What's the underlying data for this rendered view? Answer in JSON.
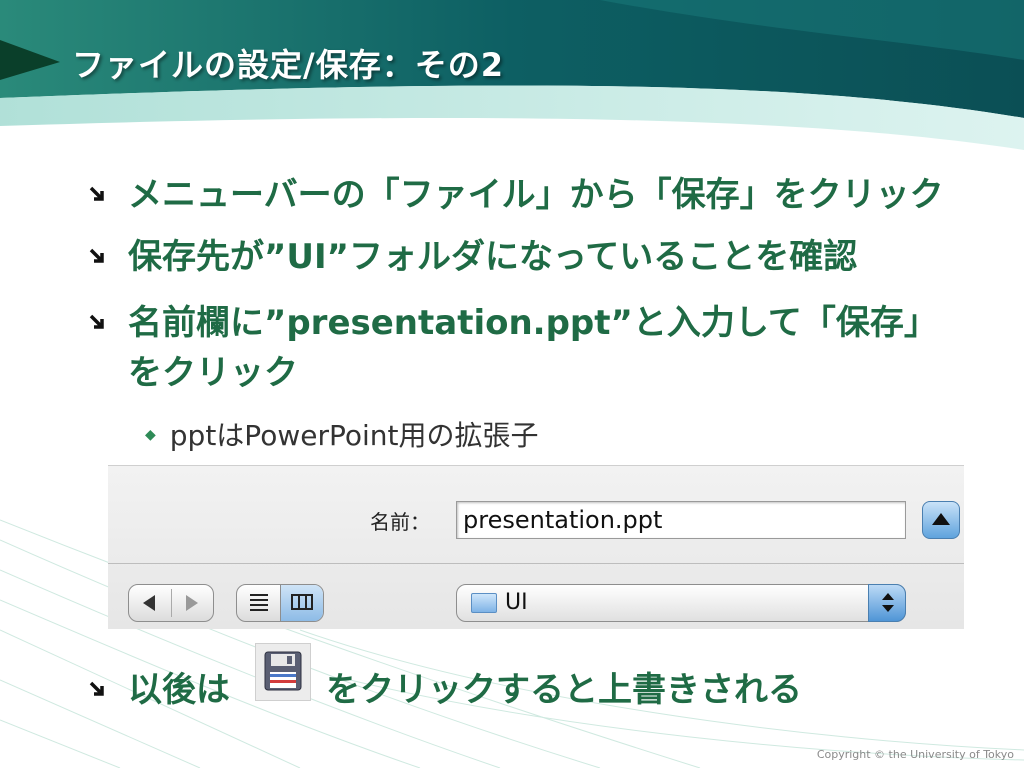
{
  "slide": {
    "title": "ファイルの設定/保存：その2",
    "bullets": [
      {
        "text": "メニューバーの「ファイル」から「保存」をクリック"
      },
      {
        "text": "保存先が”UI”フォルダになっていることを確認"
      },
      {
        "text": "名前欄に”presentation.ppt”と入力して「保存」をクリック"
      }
    ],
    "sub_bullet": "pptはPowerPoint用の拡張子",
    "last_bullet_prefix": "以後は",
    "last_bullet_suffix": "をクリックすると上書きされる",
    "copyright": "Copyright © the University of Tokyo"
  },
  "dialog": {
    "name_label": "名前：",
    "filename_value": "presentation.ppt",
    "folder_value": "UI"
  },
  "icons": {
    "bullet": "arrow-down-right-icon",
    "save": "floppy-disk-save-icon"
  },
  "colors": {
    "header_teal": "#0f5c5e",
    "bullet_green": "#1f6b45"
  }
}
